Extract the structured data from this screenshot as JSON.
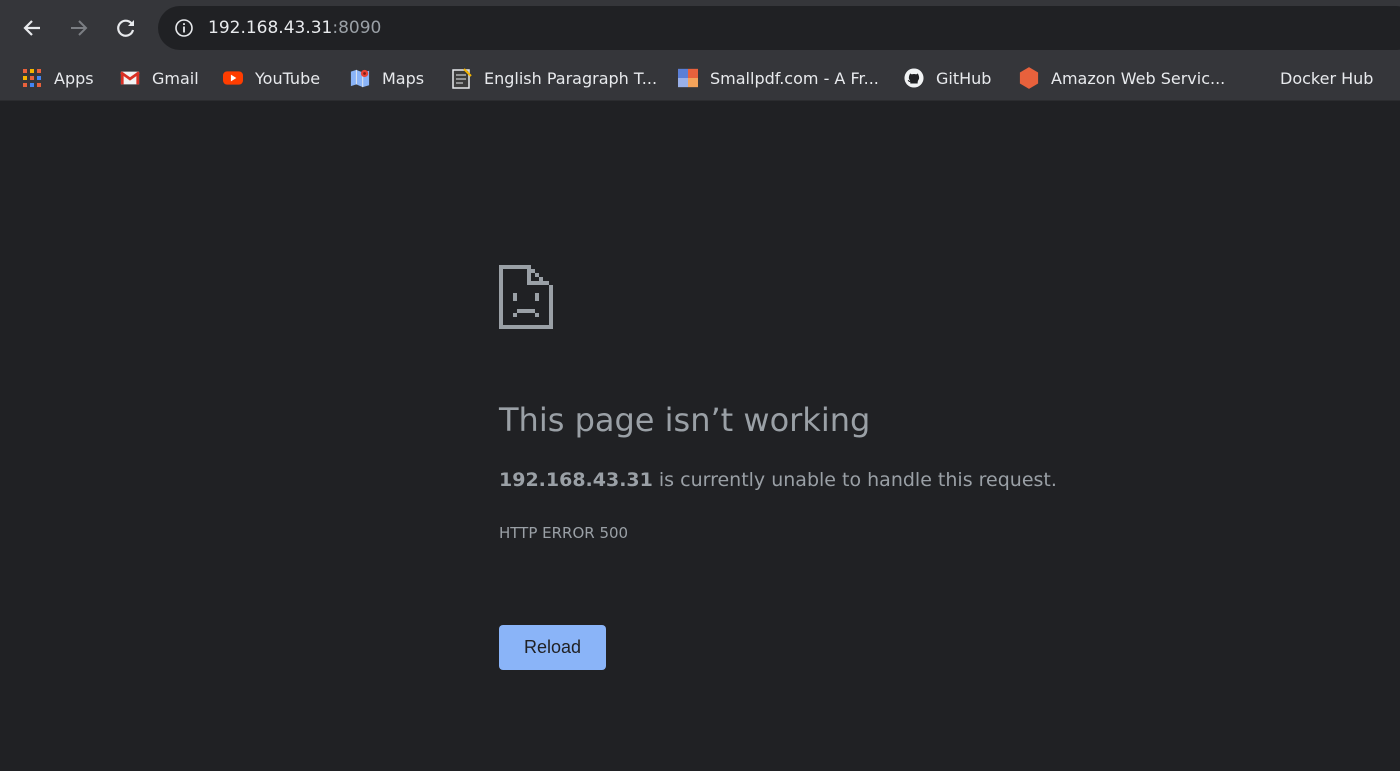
{
  "address_bar": {
    "host": "192.168.43.31",
    "port": ":8090"
  },
  "bookmarks": [
    {
      "label": "Apps",
      "icon": "apps-grid-icon"
    },
    {
      "label": "Gmail",
      "icon": "gmail-icon"
    },
    {
      "label": "YouTube",
      "icon": "youtube-icon"
    },
    {
      "label": "Maps",
      "icon": "maps-icon"
    },
    {
      "label": "English Paragraph T...",
      "icon": "notepad-icon"
    },
    {
      "label": "Smallpdf.com - A Fr...",
      "icon": "smallpdf-icon"
    },
    {
      "label": "GitHub",
      "icon": "github-icon"
    },
    {
      "label": "Amazon Web Servic...",
      "icon": "aws-hexagon-icon"
    },
    {
      "label": "Docker Hub",
      "icon": ""
    }
  ],
  "error": {
    "title": "This page isn’t working",
    "host": "192.168.43.31",
    "message": " is currently unable to handle this request.",
    "code": "HTTP ERROR 500",
    "reload_label": "Reload"
  },
  "colors": {
    "background": "#202124",
    "toolbar": "#35363a",
    "text_secondary": "#9aa0a6",
    "button_blue": "#8ab4f8"
  }
}
